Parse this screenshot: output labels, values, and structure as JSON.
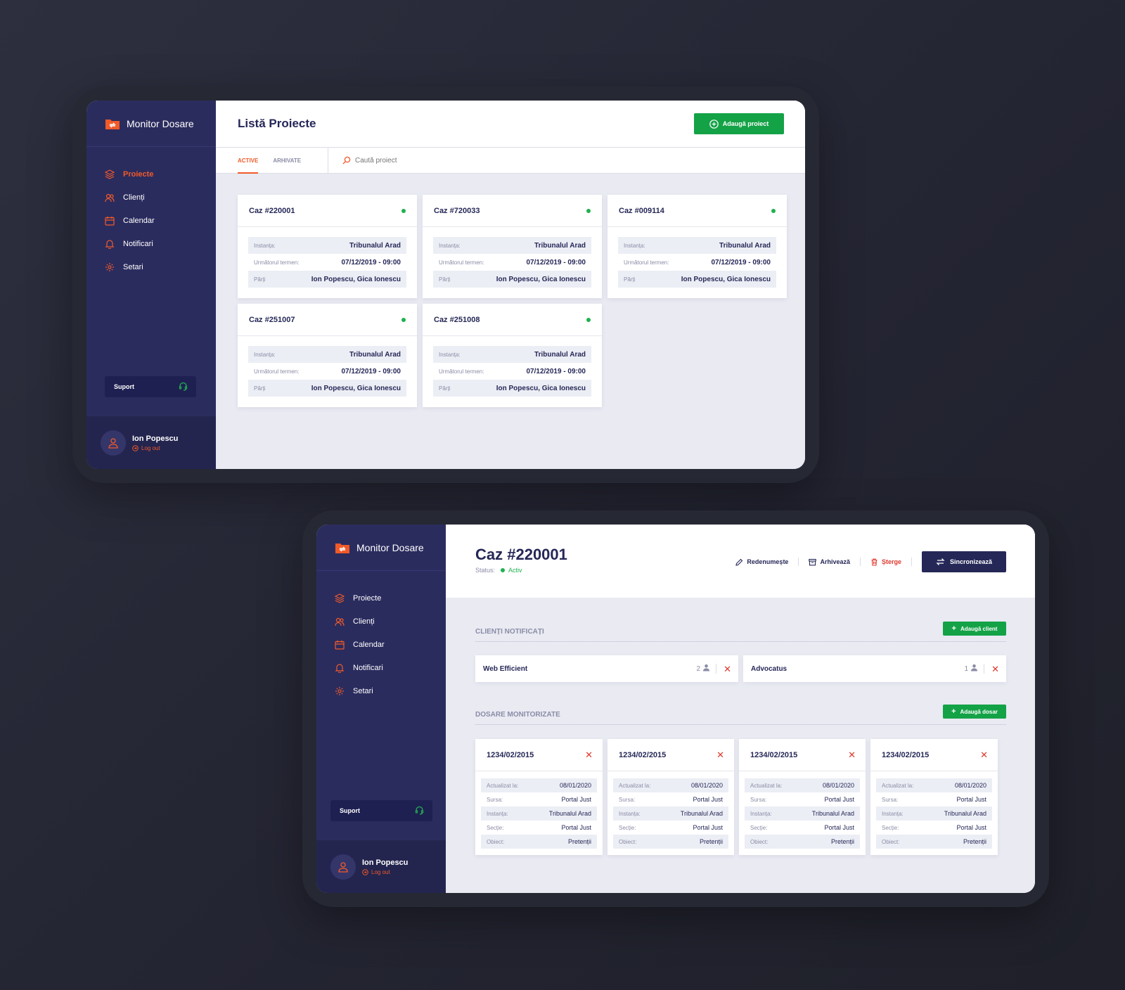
{
  "brand": {
    "name": "Monitor Dosare",
    "accent": "#f15a29",
    "sidebar_color": "#2b2c5e",
    "success_color": "#1fb14f",
    "danger_color": "#e0362c"
  },
  "nav": [
    {
      "label": "Proiecte",
      "icon": "layers-icon"
    },
    {
      "label": "Clienți",
      "icon": "users-icon"
    },
    {
      "label": "Calendar",
      "icon": "calendar-icon"
    },
    {
      "label": "Notificari",
      "icon": "bell-icon"
    },
    {
      "label": "Setari",
      "icon": "gear-icon"
    }
  ],
  "support": {
    "label": "Suport",
    "icon": "headset-icon"
  },
  "user": {
    "name": "Ion Popescu",
    "logout": "Log out"
  },
  "list_screen": {
    "title": "Listă Proiecte",
    "add_button": "Adaugă proiect",
    "tabs": [
      "ACTIVE",
      "ARHIVATE"
    ],
    "search_placeholder": "Caută proiect",
    "field_labels": {
      "court": "Instanța:",
      "next": "Următorul termen:",
      "parties": "Părți"
    },
    "cards": [
      {
        "title": "Caz #220001",
        "court": "Tribunalul Arad",
        "next": "07/12/2019 - 09:00",
        "parties": "Ion Popescu, Gica Ionescu"
      },
      {
        "title": "Caz #720033",
        "court": "Tribunalul Arad",
        "next": "07/12/2019 - 09:00",
        "parties": "Ion Popescu, Gica Ionescu"
      },
      {
        "title": "Caz #009114",
        "court": "Tribunalul Arad",
        "next": "07/12/2019 - 09:00",
        "parties": "Ion Popescu, Gica Ionescu"
      },
      {
        "title": "Caz #251007",
        "court": "Tribunalul Arad",
        "next": "07/12/2019 - 09:00",
        "parties": "Ion Popescu, Gica Ionescu"
      },
      {
        "title": "Caz #251008",
        "court": "Tribunalul Arad",
        "next": "07/12/2019 - 09:00",
        "parties": "Ion Popescu, Gica Ionescu"
      }
    ]
  },
  "detail_screen": {
    "title": "Caz #220001",
    "status_label": "Status:",
    "status_value": "Activ",
    "actions": {
      "rename": "Redenumește",
      "archive": "Arhivează",
      "delete": "Șterge",
      "sync": "Sincronizează"
    },
    "clients_section": {
      "title": "CLIENȚI NOTIFICAȚI",
      "add_button": "Adaugă client",
      "clients": [
        {
          "name": "Web Efficient",
          "count": "2"
        },
        {
          "name": "Advocatus",
          "count": "1"
        }
      ]
    },
    "files_section": {
      "title": "DOSARE MONITORIZATE",
      "add_button": "Adaugă dosar",
      "field_labels": {
        "updated": "Actualizat la:",
        "source": "Sursa:",
        "court": "Instanța:",
        "section": "Secție:",
        "object": "Obiect:"
      },
      "files": [
        {
          "title": "1234/02/2015",
          "updated": "08/01/2020",
          "source": "Portal Just",
          "court": "Tribunalul Arad",
          "section": "Portal Just",
          "object": "Pretenții"
        },
        {
          "title": "1234/02/2015",
          "updated": "08/01/2020",
          "source": "Portal Just",
          "court": "Tribunalul Arad",
          "section": "Portal Just",
          "object": "Pretenții"
        },
        {
          "title": "1234/02/2015",
          "updated": "08/01/2020",
          "source": "Portal Just",
          "court": "Tribunalul Arad",
          "section": "Portal Just",
          "object": "Pretenții"
        },
        {
          "title": "1234/02/2015",
          "updated": "08/01/2020",
          "source": "Portal Just",
          "court": "Tribunalul Arad",
          "section": "Portal Just",
          "object": "Pretenții"
        }
      ]
    }
  }
}
